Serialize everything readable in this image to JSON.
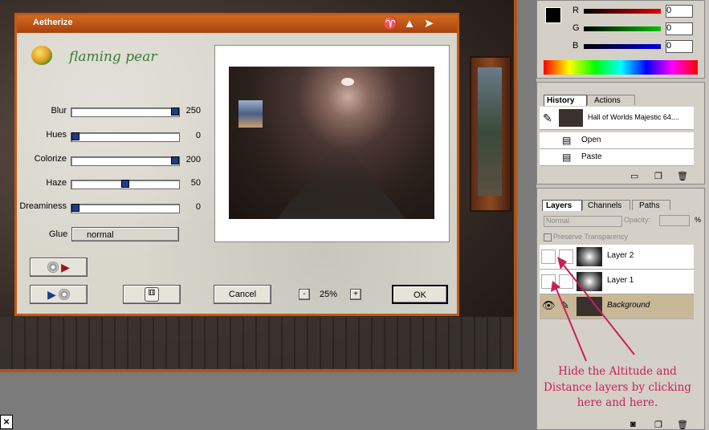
{
  "dialog": {
    "title": "Aetherize",
    "brand": "flaming pear",
    "sliders": [
      {
        "label": "Blur",
        "value": "250",
        "fraction": 1.0
      },
      {
        "label": "Hues",
        "value": "0",
        "fraction": 0.0
      },
      {
        "label": "Colorize",
        "value": "200",
        "fraction": 1.0
      },
      {
        "label": "Haze",
        "value": "50",
        "fraction": 0.5
      },
      {
        "label": "Dreaminess",
        "value": "0",
        "fraction": 0.0
      }
    ],
    "glue_label": "Glue",
    "glue_value": "normal",
    "cancel_label": "Cancel",
    "ok_label": "OK",
    "zoom_minus": "-",
    "zoom_value": "25%",
    "zoom_plus": "+"
  },
  "color_palette": {
    "r_label": "R",
    "r_value": "0",
    "g_label": "G",
    "g_value": "0",
    "b_label": "B",
    "b_value": "0"
  },
  "history": {
    "tabs": [
      "History",
      "Actions"
    ],
    "snapshot": "Hall of Worlds Majestic 64....",
    "items": [
      "Open",
      "Paste"
    ]
  },
  "layers": {
    "tabs": [
      "Layers",
      "Channels",
      "Paths"
    ],
    "blend_mode": "Normal",
    "opacity_label": "Opacity:",
    "percent": "%",
    "preserve": "Preserve Transparency",
    "items": [
      {
        "name": "Layer 2",
        "visible": false
      },
      {
        "name": "Layer 1",
        "visible": false
      },
      {
        "name": "Background",
        "visible": true
      }
    ]
  },
  "annotation": "Hide the Altitude and Distance layers by clicking here and here.",
  "close_glyph": "×",
  "colors": {
    "accent": "#c05a14",
    "annotation": "#c8205a",
    "slider_thumb": "#1e3c8a"
  }
}
